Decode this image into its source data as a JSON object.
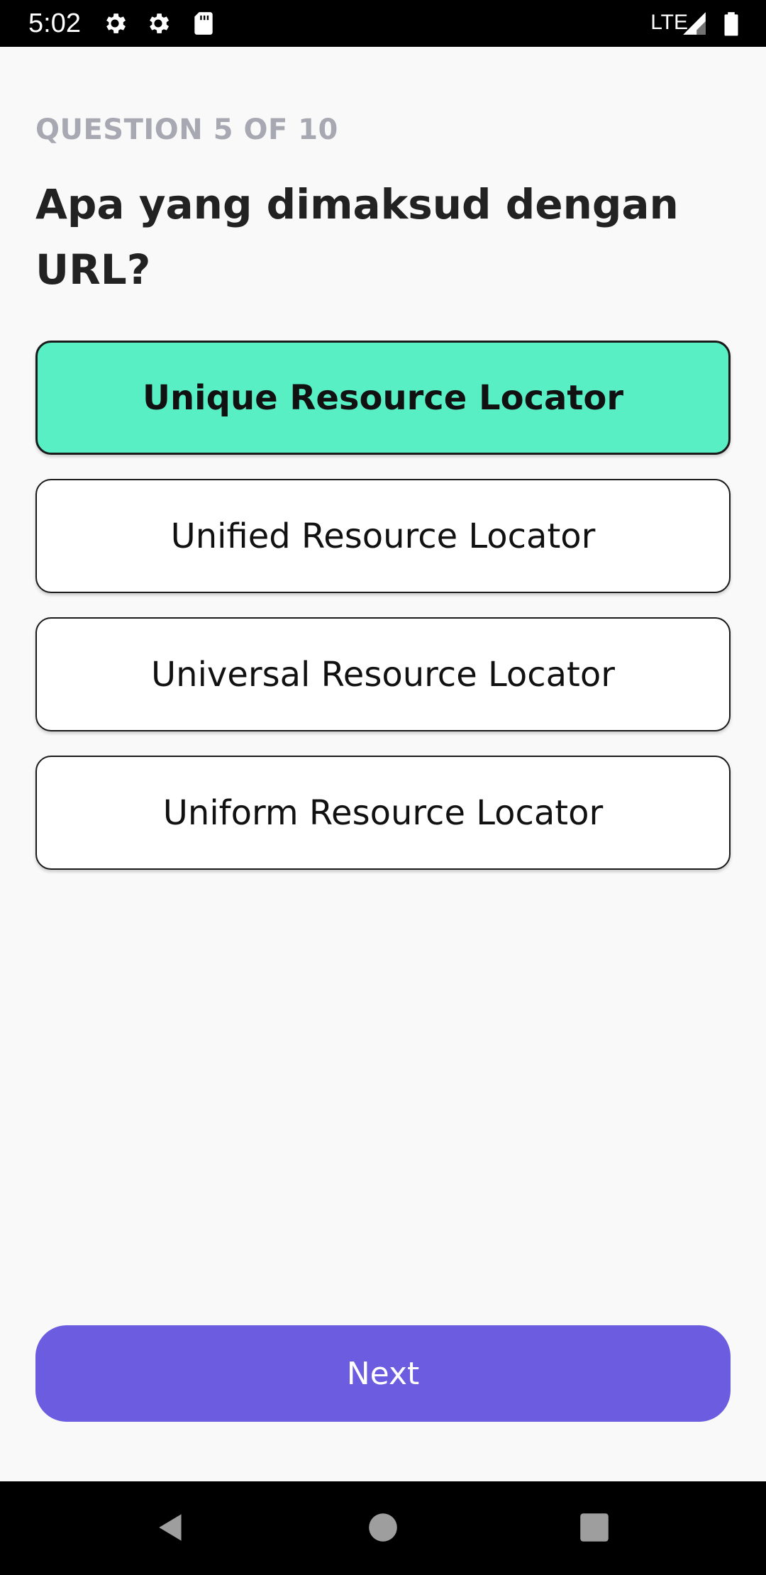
{
  "status_bar": {
    "time": "5:02",
    "network": "LTE",
    "icons": [
      "settings-icon",
      "settings-icon",
      "sd-card-icon",
      "signal-icon",
      "battery-icon"
    ]
  },
  "quiz": {
    "counter": "QUESTION 5 OF 10",
    "question": "Apa yang dimaksud dengan URL?",
    "options": [
      {
        "label": "Unique Resource Locator",
        "selected": true
      },
      {
        "label": "Unified Resource Locator",
        "selected": false
      },
      {
        "label": "Universal Resource Locator",
        "selected": false
      },
      {
        "label": "Uniform Resource Locator",
        "selected": false
      }
    ],
    "next_label": "Next"
  },
  "colors": {
    "selected_option": "#58efc5",
    "primary_button": "#6c5ce0",
    "counter_text": "#a8a8b3",
    "background": "#f9f9f9"
  },
  "nav_bar": {
    "icons": [
      "back-icon",
      "home-icon",
      "recents-icon"
    ]
  }
}
